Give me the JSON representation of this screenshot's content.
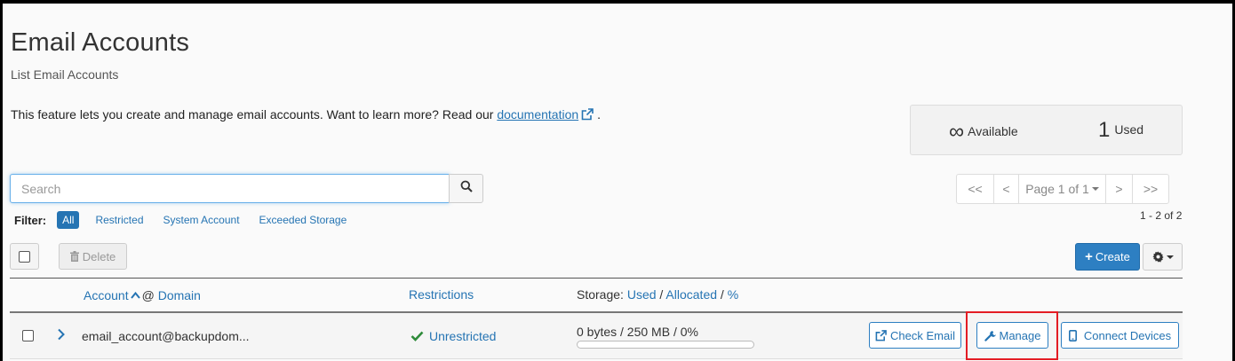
{
  "header": {
    "title": "Email Accounts",
    "subtitle": "List Email Accounts"
  },
  "intro": {
    "text": "This feature lets you create and manage email accounts. Want to learn more? Read our ",
    "link_label": "documentation",
    "trailing": "."
  },
  "stats": {
    "available_symbol": "∞",
    "available_label": "Available",
    "used_count": "1",
    "used_label": "Used"
  },
  "search": {
    "placeholder": "Search",
    "value": ""
  },
  "filter": {
    "label": "Filter:",
    "options": [
      "All",
      "Restricted",
      "System Account",
      "Exceeded Storage"
    ],
    "selected": "All"
  },
  "pagination": {
    "first": "<<",
    "prev": "<",
    "page_label": "Page 1 of 1",
    "next": ">",
    "last": ">>",
    "range": "1 - 2 of 2"
  },
  "toolbar": {
    "delete_label": "Delete",
    "create_label": "Create"
  },
  "table": {
    "columns": {
      "account": "Account",
      "at": "@",
      "domain": "Domain",
      "restrictions": "Restrictions",
      "storage_prefix": "Storage:",
      "storage_used": "Used",
      "storage_sep1": "/",
      "storage_allocated": "Allocated",
      "storage_sep2": "/",
      "storage_percent": "%"
    },
    "rows": [
      {
        "email": "email_account@backupdom...",
        "restriction": "Unrestricted",
        "storage": "0 bytes / 250 MB / 0%",
        "usage_fraction": 0,
        "actions": [
          "Check Email",
          "Manage",
          "Connect Devices"
        ]
      }
    ]
  },
  "colors": {
    "accent": "#2574b3",
    "primary_button": "#2d7fc2",
    "success": "#2e8b3a",
    "highlight": "#e31c24"
  }
}
